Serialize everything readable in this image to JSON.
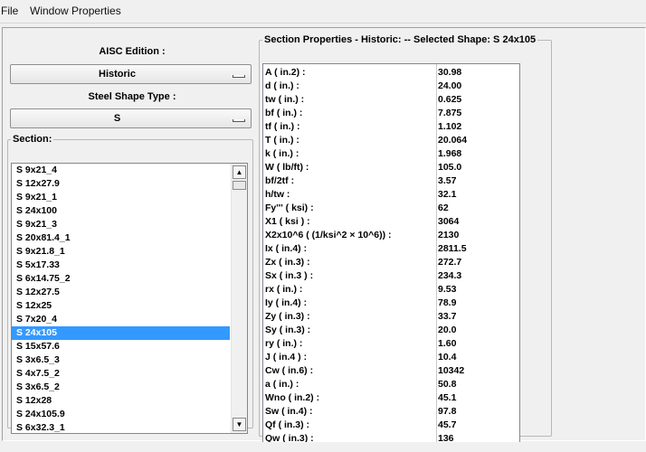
{
  "menu": {
    "file": "File",
    "window_properties": "Window Properties"
  },
  "left": {
    "aisc_label": "AISC Edition :",
    "edition_value": "Historic",
    "shape_type_label": "Steel Shape Type :",
    "shape_type_value": "S",
    "section_legend": "Section:",
    "sections": [
      "S 9x21_4",
      "S 12x27.9",
      "S 9x21_1",
      "S 24x100",
      "S 9x21_3",
      "S 20x81.4_1",
      "S 9x21.8_1",
      "S 5x17.33",
      "S 6x14.75_2",
      "S 12x27.5",
      "S 12x25",
      "S 7x20_4",
      "S 24x105",
      "S 15x57.6",
      "S 3x6.5_3",
      "S 4x7.5_2",
      "S 3x6.5_2",
      "S 12x28",
      "S 24x105.9",
      "S 6x32.3_1"
    ],
    "selected_section": "S 24x105"
  },
  "properties": {
    "legend": "Section Properties - Historic:  --  Selected Shape: S 24x105",
    "rows": [
      {
        "name": "A  ( in.2) :",
        "value": "30.98"
      },
      {
        "name": "d ( in.) :",
        "value": "24.00"
      },
      {
        "name": "tw ( in.) :",
        "value": "0.625"
      },
      {
        "name": "bf ( in.) :",
        "value": "7.875"
      },
      {
        "name": "tf ( in.) :",
        "value": "1.102"
      },
      {
        "name": "T ( in.) :",
        "value": "20.064"
      },
      {
        "name": "k ( in.) :",
        "value": "1.968"
      },
      {
        "name": "W ( lb/ft) :",
        "value": "105.0"
      },
      {
        "name": "bf/2tf :",
        "value": "3.57"
      },
      {
        "name": "h/tw :",
        "value": "32.1"
      },
      {
        "name": "Fy''' ( ksi) :",
        "value": "62"
      },
      {
        "name": "X1 ( ksi ) :",
        "value": "3064"
      },
      {
        "name": "X2x10^6 ( (1/ksi^2 × 10^6)) :",
        "value": "2130"
      },
      {
        "name": "Ix ( in.4) :",
        "value": "2811.5"
      },
      {
        "name": "Zx ( in.3) :",
        "value": "272.7"
      },
      {
        "name": "Sx ( in.3 ) :",
        "value": "234.3"
      },
      {
        "name": "rx ( in.) :",
        "value": "9.53"
      },
      {
        "name": "Iy ( in.4) :",
        "value": "78.9"
      },
      {
        "name": "Zy ( in.3) :",
        "value": "33.7"
      },
      {
        "name": "Sy ( in.3) :",
        "value": "20.0"
      },
      {
        "name": "ry ( in.) :",
        "value": "1.60"
      },
      {
        "name": "J ( in.4 ) :",
        "value": "10.4"
      },
      {
        "name": "Cw ( in.6) :",
        "value": "10342"
      },
      {
        "name": "a ( in.) :",
        "value": "50.8"
      },
      {
        "name": "Wno ( in.2) :",
        "value": "45.1"
      },
      {
        "name": "Sw ( in.4) :",
        "value": "97.8"
      },
      {
        "name": "Qf ( in.3) :",
        "value": "45.7"
      },
      {
        "name": "Qw ( in.3) :",
        "value": "136"
      }
    ]
  },
  "colors": {
    "selection": "#3399ff",
    "background": "#f0f0f0"
  }
}
